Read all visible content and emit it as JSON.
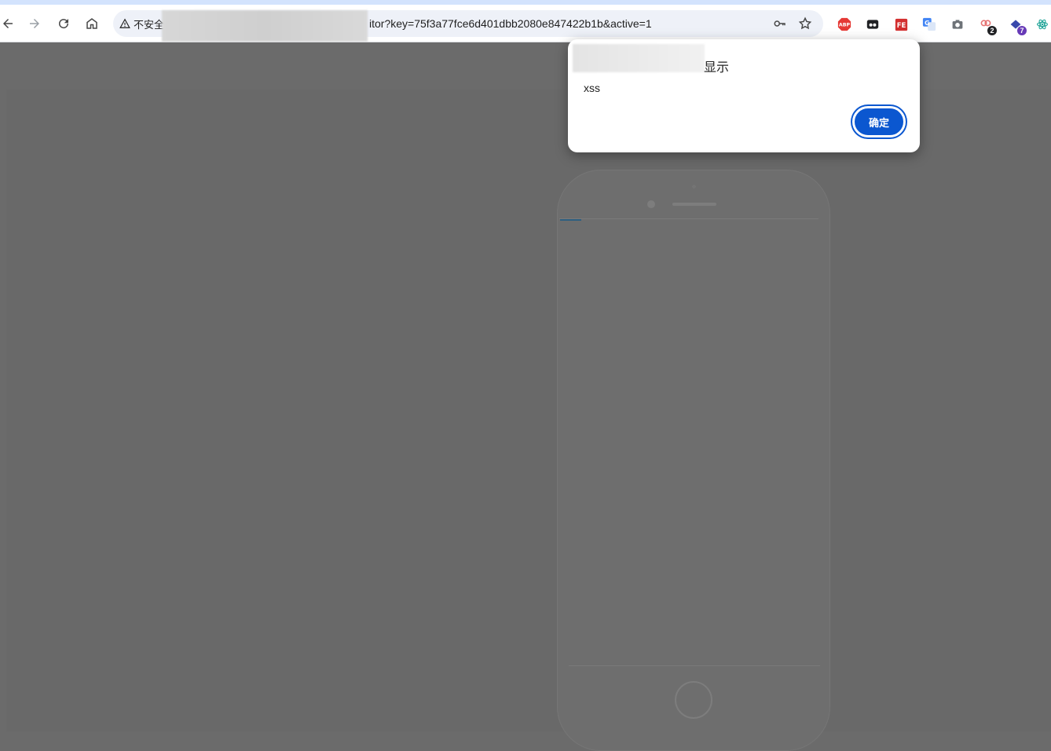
{
  "browser": {
    "security_label": "不安全",
    "url_visible": "itor?key=75f3a77fce6d401dbb2080e847422b1b&active=1",
    "extensions": [
      {
        "name": "adblock-icon",
        "text": "ABP",
        "color": "#e53935"
      },
      {
        "name": "extension-dark-icon",
        "color": "#202124"
      },
      {
        "name": "fe-helper-icon",
        "text": "FE",
        "color": "#d32f2f"
      },
      {
        "name": "google-translate-icon",
        "text": "G",
        "color": "#4285f4"
      },
      {
        "name": "camera-icon",
        "color": "#5f6368"
      },
      {
        "name": "link-extension-icon",
        "badge": "2",
        "color": "#e57373",
        "badge_color": "#202124"
      },
      {
        "name": "tag-extension-icon",
        "badge": "7",
        "color": "#3949ab",
        "badge_color": "#673ab7"
      },
      {
        "name": "react-devtools-icon",
        "color": "#26a69a"
      }
    ]
  },
  "dialog": {
    "title_suffix": "显示",
    "message": "xss",
    "ok_label": "确定",
    "accent": "#0b57d0"
  }
}
